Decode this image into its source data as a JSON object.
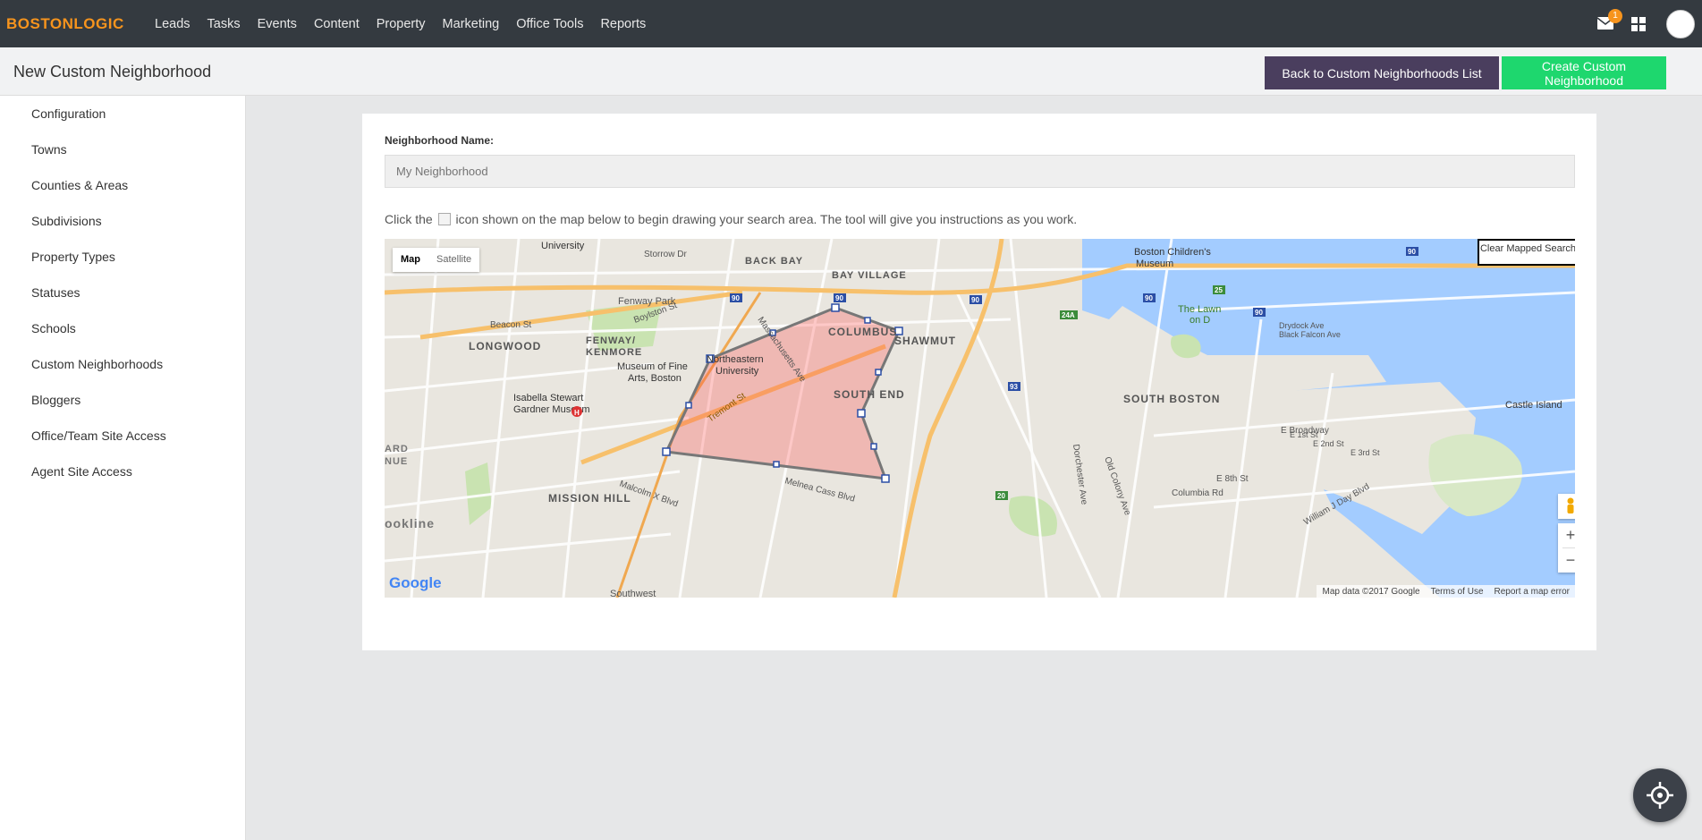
{
  "brand": {
    "logo_text": "BOSTONLOGIC",
    "accent": "#f7941d"
  },
  "nav": {
    "items": [
      {
        "label": "Leads"
      },
      {
        "label": "Tasks"
      },
      {
        "label": "Events"
      },
      {
        "label": "Content"
      },
      {
        "label": "Property"
      },
      {
        "label": "Marketing"
      },
      {
        "label": "Office Tools"
      },
      {
        "label": "Reports"
      }
    ],
    "mail_icon": "mail-icon",
    "mail_badge": "1",
    "apps_icon": "grid-icon"
  },
  "header": {
    "title": "New Custom Neighborhood",
    "back_label": "Back to Custom Neighborhoods List",
    "create_label": "Create Custom Neighborhood",
    "back_color": "#4a3e5e",
    "create_color": "#1ed76e"
  },
  "sidebar": {
    "items": [
      {
        "label": "Configuration"
      },
      {
        "label": "Towns"
      },
      {
        "label": "Counties & Areas"
      },
      {
        "label": "Subdivisions"
      },
      {
        "label": "Property Types"
      },
      {
        "label": "Statuses"
      },
      {
        "label": "Schools"
      },
      {
        "label": "Custom Neighborhoods"
      },
      {
        "label": "Bloggers"
      },
      {
        "label": "Office/Team Site Access"
      },
      {
        "label": "Agent Site Access"
      }
    ]
  },
  "form": {
    "name_label": "Neighborhood Name:",
    "name_placeholder": "My Neighborhood",
    "instructions_before": "Click the",
    "instructions_after": "icon shown on the map below to begin drawing your search area. The tool will give you instructions as you work."
  },
  "map": {
    "type_map": "Map",
    "type_satellite": "Satellite",
    "clear_label": "Clear Mapped Search",
    "zoom_in": "+",
    "zoom_out": "−",
    "google": "Google",
    "attribution": [
      "Map data ©2017 Google",
      "Terms of Use",
      "Report a map error"
    ],
    "labels": [
      {
        "text": "BACK BAY"
      },
      {
        "text": "BAY VILLAGE"
      },
      {
        "text": "Fenway Park"
      },
      {
        "text": "LONGWOOD"
      },
      {
        "text": "FENWAY/"
      },
      {
        "text": "KENMORE"
      },
      {
        "text": "Museum of Fine"
      },
      {
        "text": "Arts, Boston"
      },
      {
        "text": "Northeastern"
      },
      {
        "text": "University"
      },
      {
        "text": "Isabella Stewart"
      },
      {
        "text": "Gardner Museum"
      },
      {
        "text": "COLUMBUS"
      },
      {
        "text": "SHAWMUT"
      },
      {
        "text": "SOUTH END"
      },
      {
        "text": "MISSION HILL"
      },
      {
        "text": "SOUTH BOSTON"
      },
      {
        "text": "Boston Children's"
      },
      {
        "text": "Museum"
      },
      {
        "text": "The Lawn"
      },
      {
        "text": "on D"
      },
      {
        "text": "Castle Island"
      },
      {
        "text": "Drydock Ave"
      },
      {
        "text": "Black Falcon Ave"
      },
      {
        "text": "Columbia Rd"
      },
      {
        "text": "E Broadway"
      },
      {
        "text": "E 8th St"
      },
      {
        "text": "William J Day Blvd"
      },
      {
        "text": "Tremont St"
      },
      {
        "text": "Massachusetts Ave"
      },
      {
        "text": "Malcolm X Blvd"
      },
      {
        "text": "Melnea Cass Blvd"
      },
      {
        "text": "Beacon St"
      },
      {
        "text": "Boylston St"
      },
      {
        "text": "University"
      },
      {
        "text": "Storrow Dr"
      },
      {
        "text": "Southwest"
      },
      {
        "text": "ookline"
      },
      {
        "text": "ARD"
      },
      {
        "text": "NUE"
      },
      {
        "text": "Dorchester Ave"
      },
      {
        "text": "Old Colony Ave"
      },
      {
        "text": "E 1st St"
      },
      {
        "text": "E 2nd St"
      },
      {
        "text": "E 3rd St"
      }
    ]
  },
  "fab_icon": "crosshair-icon"
}
